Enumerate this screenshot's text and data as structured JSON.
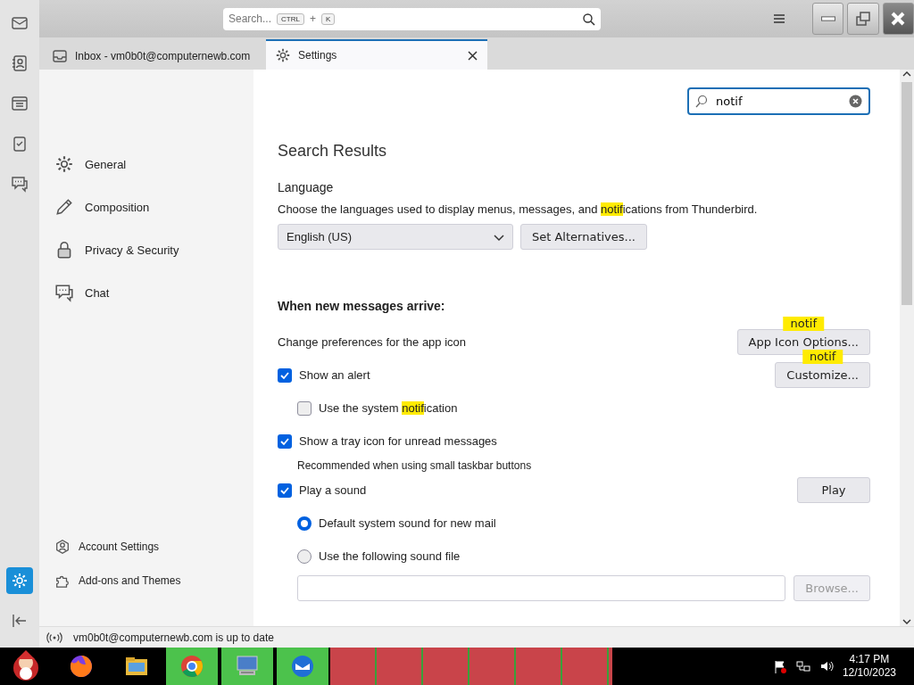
{
  "spaces_toolbar": {
    "items": [
      {
        "kind": "mail",
        "selected": false
      },
      {
        "kind": "address-book",
        "selected": false
      },
      {
        "kind": "calendar",
        "selected": false
      },
      {
        "kind": "tasks",
        "selected": false
      },
      {
        "kind": "chat",
        "selected": false
      }
    ],
    "bottom_items": [
      {
        "kind": "settings",
        "selected": true
      },
      {
        "kind": "collapse",
        "selected": false
      }
    ]
  },
  "title_bar": {
    "search": {
      "placeholder": "Search...",
      "shortcut_keys": [
        "CTRL",
        "K"
      ],
      "shortcut_joiner": "+"
    }
  },
  "tabs": [
    {
      "kind": "inbox",
      "label": "Inbox - vm0b0t@computernewb.com",
      "selected": false
    },
    {
      "kind": "settings",
      "label": "Settings",
      "selected": true
    }
  ],
  "settings_nav": {
    "items": [
      {
        "kind": "general",
        "label": "General"
      },
      {
        "kind": "composition",
        "label": "Composition"
      },
      {
        "kind": "privacy",
        "label": "Privacy & Security"
      },
      {
        "kind": "chat",
        "label": "Chat"
      }
    ],
    "footer_items": [
      {
        "kind": "account",
        "label": "Account Settings"
      },
      {
        "kind": "addons",
        "label": "Add-ons and Themes"
      }
    ]
  },
  "filter": {
    "value": "notif"
  },
  "heading": "Search Results",
  "language": {
    "title": "Language",
    "description": [
      {
        "text": "Choose the languages used to display menus, messages, and ",
        "highlight": false
      },
      {
        "text": "notif",
        "highlight": true
      },
      {
        "text": "ications from Thunderbird.",
        "highlight": false
      }
    ],
    "dropdown": {
      "value": "English (US)"
    },
    "button": "Set Alternatives..."
  },
  "new_messages": {
    "title": "When new messages arrive:",
    "rows": [
      {
        "kind": "text",
        "label": [
          {
            "text": "Change preferences for the app icon",
            "highlight": false
          }
        ],
        "button": {
          "label": "App Icon Options...",
          "tooltip": "notif"
        }
      },
      {
        "kind": "checkbox",
        "label": [
          {
            "text": "Show an alert",
            "highlight": false
          }
        ],
        "checked": true,
        "button": {
          "label": "Customize...",
          "tooltip": "notif"
        },
        "children": [
          {
            "kind": "checkbox",
            "label": [
              {
                "text": "Use the system ",
                "highlight": false
              },
              {
                "text": "notif",
                "highlight": true
              },
              {
                "text": "ication",
                "highlight": false
              }
            ],
            "checked": false
          }
        ]
      },
      {
        "kind": "checkbox",
        "label": [
          {
            "text": "Show a tray icon for unread messages",
            "highlight": false
          }
        ],
        "checked": true,
        "children": [
          {
            "kind": "note",
            "label": [
              {
                "text": "Recommended when using small taskbar buttons",
                "highlight": false
              }
            ]
          }
        ]
      },
      {
        "kind": "checkbox",
        "label": [
          {
            "text": "Play a sound",
            "highlight": false
          }
        ],
        "checked": true,
        "button": {
          "label": "Play"
        },
        "children": [
          {
            "kind": "radio",
            "label": [
              {
                "text": "Default system sound for new mail",
                "highlight": false
              }
            ],
            "selected": true
          },
          {
            "kind": "radio",
            "label": [
              {
                "text": "Use the following sound file",
                "highlight": false
              }
            ],
            "selected": false
          },
          {
            "kind": "file",
            "button": {
              "label": "Browse...",
              "disabled": true
            }
          }
        ]
      }
    ]
  },
  "status_bar": {
    "text": "vm0b0t@computernewb.com is up to date"
  },
  "taskbar": {
    "apps": [
      {
        "kind": "firefox",
        "active": false
      },
      {
        "kind": "folder",
        "active": false
      },
      {
        "kind": "chrome",
        "active": true
      },
      {
        "kind": "computer",
        "active": true
      },
      {
        "kind": "thunderbird",
        "active": true
      }
    ],
    "clock": {
      "time": "4:17 PM",
      "date": "12/10/2023"
    }
  }
}
